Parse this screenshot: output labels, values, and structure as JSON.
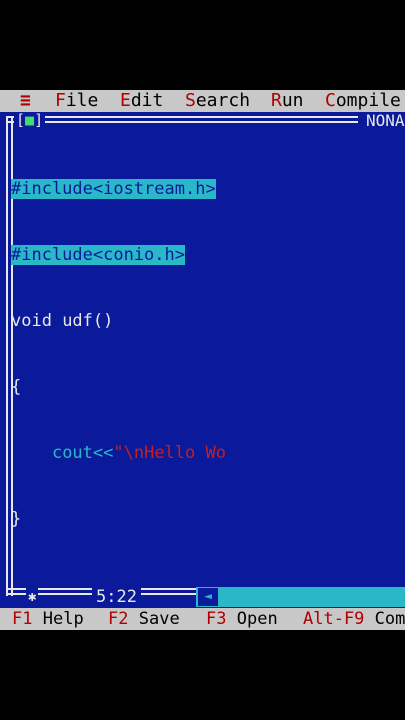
{
  "menubar": {
    "system_icon": "≡",
    "items": [
      {
        "hot": "F",
        "rest": "ile"
      },
      {
        "hot": "E",
        "rest": "dit"
      },
      {
        "hot": "S",
        "rest": "earch"
      },
      {
        "hot": "R",
        "rest": "un"
      },
      {
        "hot": "C",
        "rest": "ompile"
      }
    ]
  },
  "window": {
    "close_box_open": "[",
    "close_box_icon": "■",
    "close_box_close": "]",
    "title": "NONA"
  },
  "editor": {
    "lines": [
      {
        "text": "#include<iostream.h>"
      },
      {
        "text": "#include<conio.h>"
      },
      {
        "part1": "void ",
        "part2": "udf",
        "part3": "()"
      },
      {
        "text": "{"
      },
      {
        "indent": "    ",
        "code": "cout<<",
        "string": "\"\\nHello Wo"
      },
      {
        "text": "}"
      }
    ]
  },
  "status": {
    "cursor_position": "5:22",
    "left_arrow_icon": "◄"
  },
  "fkeys": [
    {
      "key": "F1",
      "label": "Help"
    },
    {
      "key": "F2",
      "label": "Save"
    },
    {
      "key": "F3",
      "label": "Open"
    },
    {
      "key": "Alt-F9",
      "label": "Com"
    }
  ],
  "colors": {
    "background": "#0a1a9a",
    "menu_bg": "#c8c8c8",
    "hotkey": "#b00000",
    "selection": "#2ab8c8",
    "string": "#c81e1e"
  }
}
